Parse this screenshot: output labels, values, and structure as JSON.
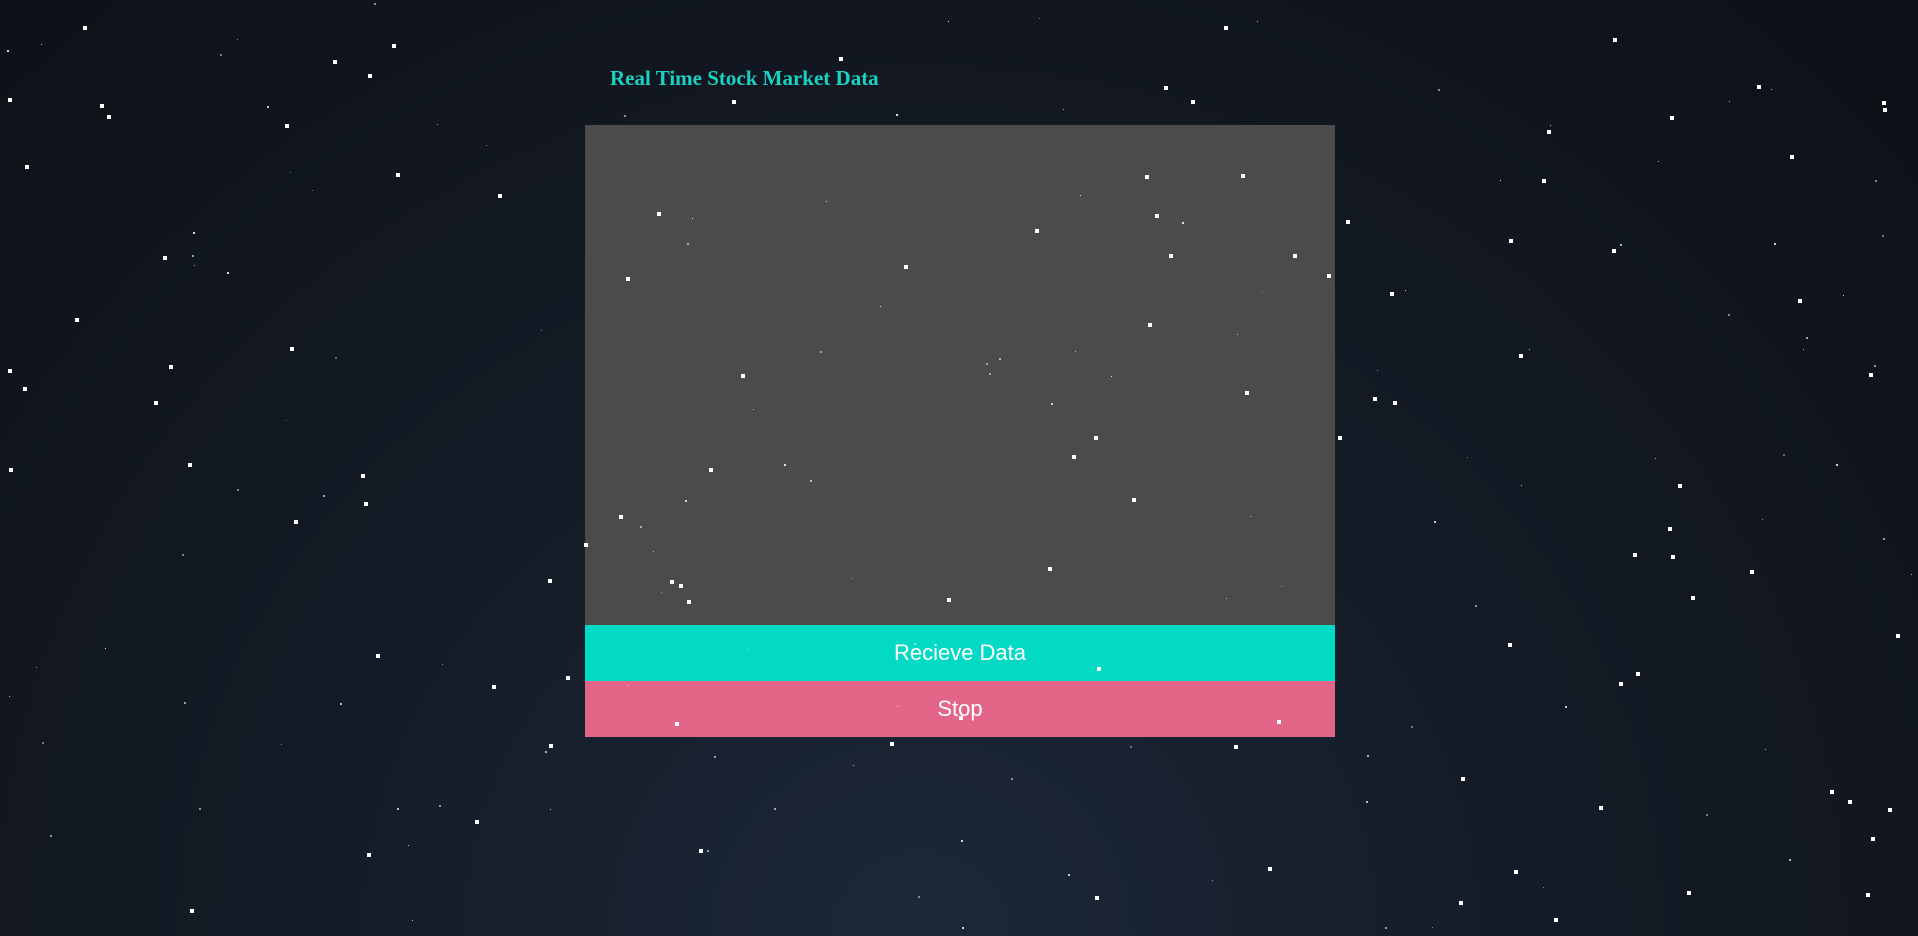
{
  "page": {
    "title": "Real Time Stock Market Data"
  },
  "controls": {
    "receive_label": "Recieve Data",
    "stop_label": "Stop"
  },
  "colors": {
    "title": "#1ad1c2",
    "chart_background": "#4c4b4a",
    "receive_button": "#03dac6",
    "stop_button": "#e36588",
    "background_top": "#0d1016",
    "background_bottom": "#1c2838",
    "star": "#ffffff"
  },
  "decoration": {
    "background": "starfield"
  }
}
